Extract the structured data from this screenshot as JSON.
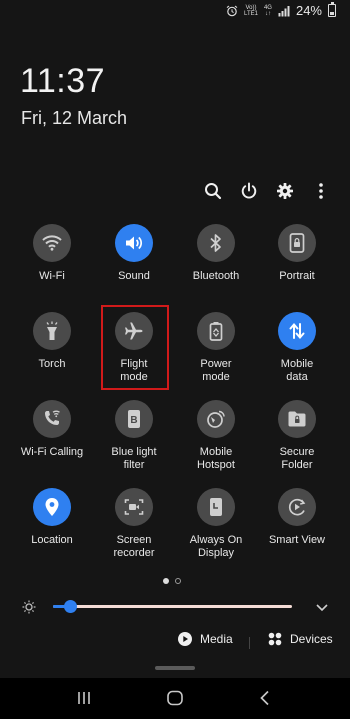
{
  "status_bar": {
    "net_top": "Vo))",
    "net_mid": "LTE1",
    "signal_gen": "4G",
    "battery_text": "24%"
  },
  "lock": {
    "time": "11:37",
    "date": "Fri, 12 March"
  },
  "top_actions": [
    "search-icon",
    "power-icon",
    "gear-icon",
    "more-vert-icon"
  ],
  "tiles": [
    {
      "label": "Wi-Fi",
      "icon": "wifi-icon",
      "on": false
    },
    {
      "label": "Sound",
      "icon": "sound-icon",
      "on": true
    },
    {
      "label": "Bluetooth",
      "icon": "bluetooth-icon",
      "on": false
    },
    {
      "label": "Portrait",
      "icon": "portrait-lock-icon",
      "on": false
    },
    {
      "label": "Torch",
      "icon": "torch-icon",
      "on": false
    },
    {
      "label": "Flight\nmode",
      "icon": "airplane-icon",
      "on": false
    },
    {
      "label": "Power\nmode",
      "icon": "power-mode-icon",
      "on": false
    },
    {
      "label": "Mobile\ndata",
      "icon": "mobile-data-icon",
      "on": true
    },
    {
      "label": "Wi-Fi Calling",
      "icon": "wifi-calling-icon",
      "on": false
    },
    {
      "label": "Blue light\nfilter",
      "icon": "blue-light-icon",
      "on": false
    },
    {
      "label": "Mobile\nHotspot",
      "icon": "hotspot-icon",
      "on": false
    },
    {
      "label": "Secure\nFolder",
      "icon": "secure-folder-icon",
      "on": false
    },
    {
      "label": "Location",
      "icon": "location-icon",
      "on": true
    },
    {
      "label": "Screen\nrecorder",
      "icon": "screen-recorder-icon",
      "on": false
    },
    {
      "label": "Always On\nDisplay",
      "icon": "always-on-display-icon",
      "on": false
    },
    {
      "label": "Smart View",
      "icon": "smart-view-icon",
      "on": false
    }
  ],
  "page_indicator": {
    "pages": 2,
    "current": 1
  },
  "brightness": {
    "level": 0.07
  },
  "media": {
    "media_label": "Media",
    "devices_label": "Devices"
  },
  "colors": {
    "accent": "#2f80f0",
    "tile_off": "#4a4a4a",
    "highlight": "#d11a1a",
    "background": "#151515"
  },
  "navbar": [
    "recents-icon",
    "home-icon",
    "back-icon"
  ]
}
